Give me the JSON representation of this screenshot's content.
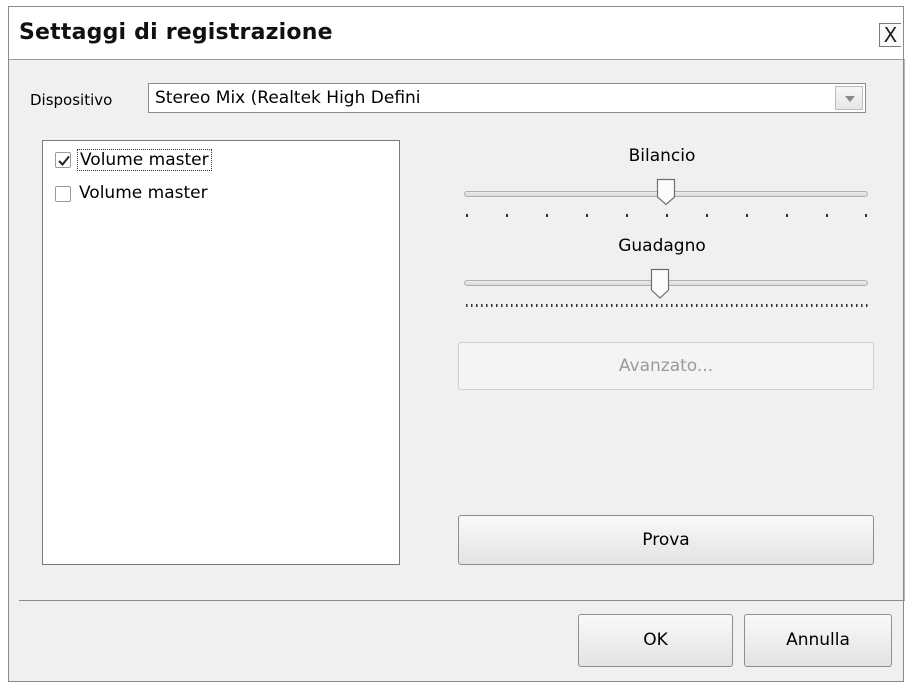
{
  "dialog": {
    "title": "Settaggi di registrazione",
    "close_label": "X"
  },
  "device": {
    "label": "Dispositivo",
    "selected": "Stereo Mix (Realtek High Defini"
  },
  "channels": [
    {
      "label": "Volume master",
      "checked": true
    },
    {
      "label": "Volume master",
      "checked": false
    }
  ],
  "balance": {
    "label": "Bilancio",
    "value": 0.5
  },
  "gain": {
    "label": "Guadagno",
    "value": 0.5
  },
  "buttons": {
    "advanced": "Avanzato...",
    "test": "Prova",
    "ok": "OK",
    "cancel": "Annulla"
  }
}
